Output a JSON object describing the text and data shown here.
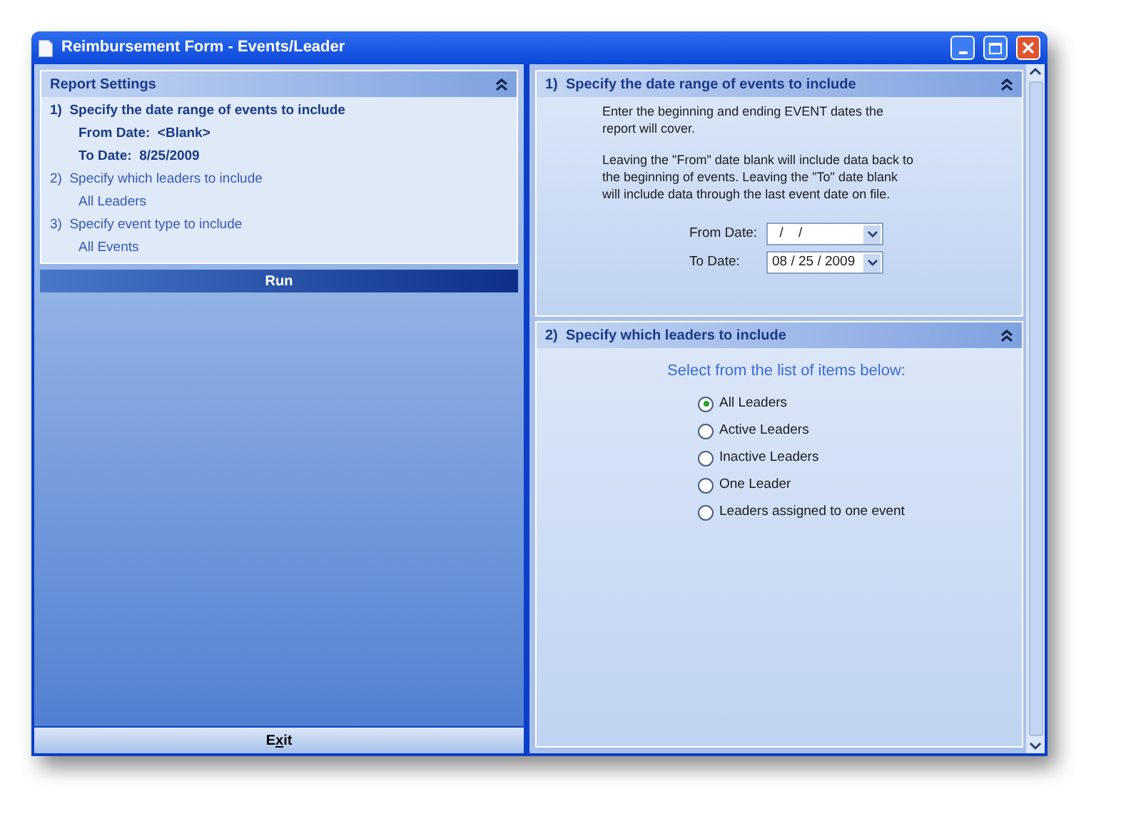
{
  "window": {
    "title": "Reimbursement Form - Events/Leader"
  },
  "report_settings": {
    "title": "Report Settings",
    "items": [
      {
        "label": "1)  Specify the date range of events to include",
        "active": true,
        "details": [
          "From Date:  <Blank>",
          "To Date:  8/25/2009"
        ]
      },
      {
        "label": "2)  Specify which leaders to include",
        "active": false,
        "details": [
          "All Leaders"
        ]
      },
      {
        "label": "3)  Specify event type to include",
        "active": false,
        "details": [
          "All Events"
        ]
      }
    ]
  },
  "run_button": {
    "label": "Run"
  },
  "exit_button": {
    "label_before_key": "E",
    "access_key": "x",
    "label_after_key": "it"
  },
  "date_section": {
    "title": "1)  Specify the date range of events to include",
    "paragraphs": [
      "Enter the beginning and ending EVENT dates the report will cover.",
      "Leaving the \"From\" date blank will include data back to the beginning of events. Leaving the \"To\" date blank will include data through the last event date on file."
    ],
    "fields": [
      {
        "label": "From Date:",
        "value": "  /    /"
      },
      {
        "label": "To Date:",
        "value": "08 / 25 / 2009"
      }
    ]
  },
  "leaders_section": {
    "title": "2)  Specify which leaders to include",
    "prompt": "Select from the list of items below:",
    "options": [
      {
        "label": "All Leaders",
        "selected": true
      },
      {
        "label": "Active Leaders",
        "selected": false
      },
      {
        "label": "Inactive Leaders",
        "selected": false
      },
      {
        "label": "One Leader",
        "selected": false
      },
      {
        "label": "Leaders assigned to one event",
        "selected": false
      }
    ]
  }
}
